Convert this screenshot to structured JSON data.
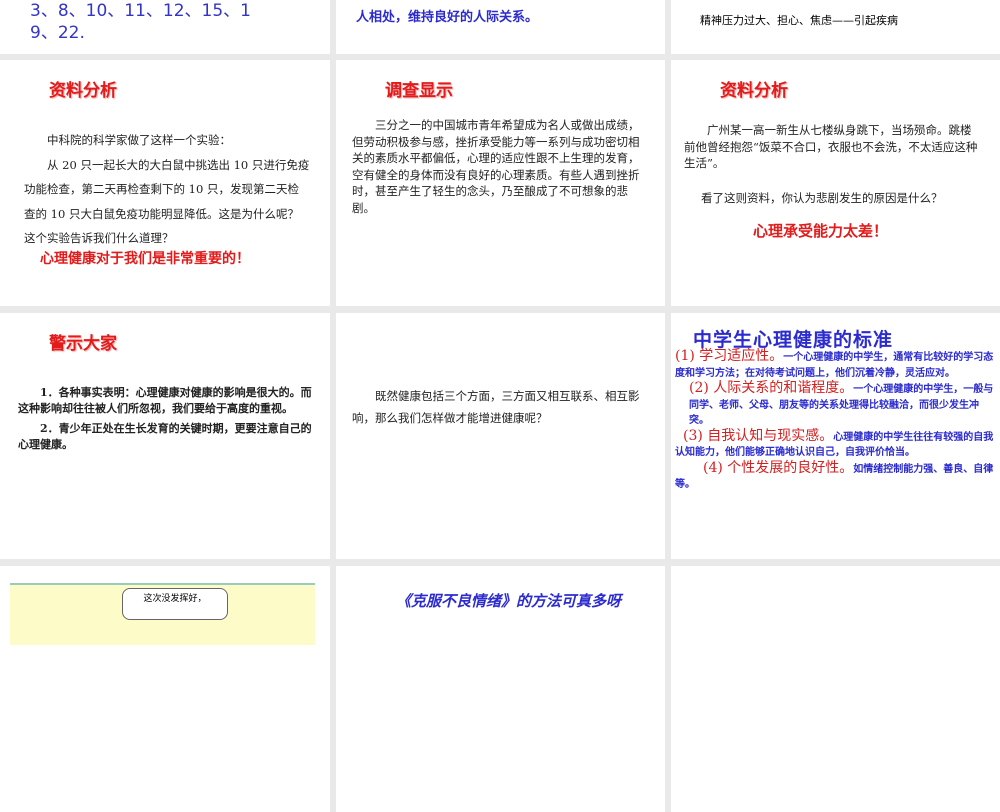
{
  "slides": {
    "s1": {
      "line1": "3、8、10、11、12、15、1",
      "line2": "9、22."
    },
    "s2": {
      "line1": "人相处，维持良好的人际关系。"
    },
    "s3": {
      "line1": "精神压力过大、担心、焦虑——引起疾病"
    },
    "s4": {
      "title": "资料分析",
      "p1": "中科院的科学家做了这样一个实验：",
      "p2": "从 20 只一起长大的大白鼠中挑选出 10 只进行免疫功能检查，第二天再检查剩下的 10 只，发现第二天检查的 10 只大白鼠免疫功能明显降低。这是为什么呢？这个实验告诉我们什么道理？",
      "conclusion": "心理健康对于我们是非常重要的！"
    },
    "s5": {
      "title": "调查显示",
      "p1": "三分之一的中国城市青年希望成为名人或做出成绩，但劳动积极参与感，挫折承受能力等一系列与成功密切相关的素质水平都偏低，心理的适应性跟不上生理的发育，空有健全的身体而没有良好的心理素质。有些人遇到挫折时，甚至产生了轻生的念头，乃至酿成了不可想象的悲剧。"
    },
    "s6": {
      "title": "资料分析",
      "p1": "广州某一高一新生从七楼纵身跳下，当场殒命。跳楼前他曾经抱怨“饭菜不合口，衣服也不会洗，不太适应这种生活”。",
      "p2": "看了这则资料，你认为悲剧发生的原因是什么？",
      "conclusion": "心理承受能力太差！"
    },
    "s7": {
      "title": "警示大家",
      "p1": "1．各种事实表明：心理健康对健康的影响是很大的。而这种影响却往往被人们所忽视，我们要给于高度的重视。",
      "p2": "2．青少年正处在生长发育的关键时期，更要注意自己的心理健康。"
    },
    "s8": {
      "p1": "既然健康包括三个方面，三方面又相互联系、相互影响，那么我们怎样做才能增进健康呢？"
    },
    "s9": {
      "title": "中学生心理健康的标准",
      "items": [
        {
          "head": "(1) 学习适应性。",
          "text": "一个心理健康的中学生，通常有比较好的学习态度和学习方法；在对待考试问题上，他们沉着冷静，灵活应对。"
        },
        {
          "head": "(2) 人际关系的和谐程度。",
          "text": "一个心理健康的中学生，一般与同学、老师、父母、朋友等的关系处理得比较融洽，而很少发生冲突。"
        },
        {
          "head": "(3) 自我认知与现实感。",
          "text": "心理健康的中学生往往有较强的自我认知能力，他们能够正确地认识自己，自我评价恰当。"
        },
        {
          "head": "(4) 个性发展的良好性。",
          "text": "如情绪控制能力强、善良、自律等。"
        }
      ]
    },
    "s10": {
      "bubble": "这次没发挥好，"
    },
    "s11": {
      "title": "《克服不良情绪》的方法可真多呀"
    }
  }
}
